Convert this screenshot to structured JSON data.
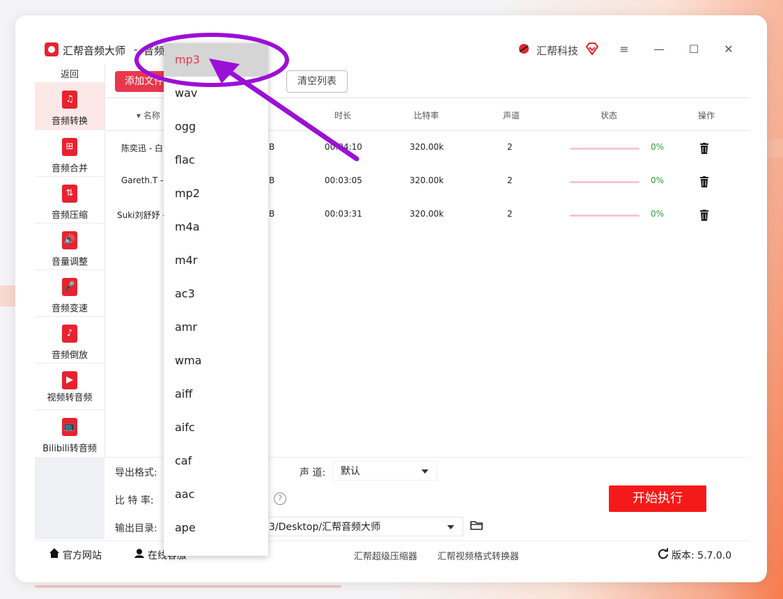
{
  "window": {
    "app_title": "汇帮音频大师",
    "title_sep": "-",
    "tab_title": "音频",
    "brand_name": "汇帮科技",
    "controls": [
      "≡",
      "—",
      "☐",
      "✕"
    ]
  },
  "sidebar": {
    "back": "返回",
    "items": [
      {
        "label": "音频转换",
        "icon": "♫"
      },
      {
        "label": "音频合并",
        "icon": "⊞"
      },
      {
        "label": "音频压缩",
        "icon": "⇅"
      },
      {
        "label": "音量调整",
        "icon": "🔊"
      },
      {
        "label": "音频变速",
        "icon": "🎤"
      },
      {
        "label": "音频倒放",
        "icon": "♪"
      },
      {
        "label": "视频转音频",
        "icon": "▶"
      },
      {
        "label": "Bilibili转音频",
        "icon": "📺"
      }
    ]
  },
  "toolbar": {
    "add_files": "添加文件",
    "clear_list": "清空列表"
  },
  "table": {
    "headers": {
      "name": "▾ 名称",
      "duration": "时长",
      "bitrate": "比特率",
      "channels": "声道",
      "status": "状态",
      "action": "操作"
    },
    "rows": [
      {
        "name": "陈奕迅 - 白",
        "size": "B",
        "duration": "00:04:10",
        "bitrate": "320.00k",
        "channels": "2",
        "progress": 0,
        "pct": "0%"
      },
      {
        "name": "Gareth.T -",
        "size": "B",
        "duration": "00:03:05",
        "bitrate": "320.00k",
        "channels": "2",
        "progress": 0,
        "pct": "0%"
      },
      {
        "name": "Suki刘舒妤 -",
        "size": "B",
        "duration": "00:03:31",
        "bitrate": "320.00k",
        "channels": "2",
        "progress": 0,
        "pct": "0%"
      }
    ]
  },
  "settings": {
    "export_format_label": "导出格式:",
    "channel_label": "声 道:",
    "channel_value": "默认",
    "bitrate_label": "比 特 率:",
    "help": "?",
    "output_dir_label": "输出目录:",
    "output_dir_value": "3/Desktop/汇帮音频大师",
    "start_button": "开始执行"
  },
  "footer": {
    "website": "官方网站",
    "online_service": "在线客服",
    "link1": "汇帮超级压缩器",
    "link2": "汇帮视频格式转换器",
    "version": "版本:  5.7.0.0"
  },
  "dropdown": {
    "selected": "mp3",
    "options": [
      "mp3",
      "wav",
      "ogg",
      "flac",
      "mp2",
      "m4a",
      "m4r",
      "ac3",
      "amr",
      "wma",
      "aiff",
      "aifc",
      "caf",
      "aac",
      "ape"
    ]
  },
  "colors": {
    "accent_red": "#e8384d",
    "start_red": "#f51a1a",
    "annotation_purple": "#9b10d6",
    "status_green": "#2a9d3a"
  }
}
